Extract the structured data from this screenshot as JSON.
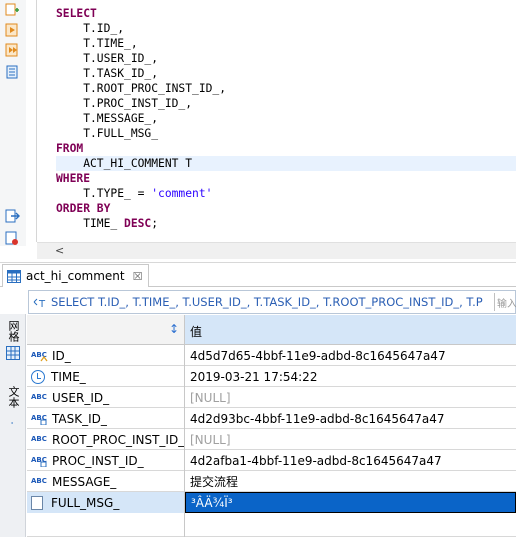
{
  "editor": {
    "lines": [
      {
        "parts": [
          {
            "t": "SELECT",
            "c": "kw"
          }
        ]
      },
      {
        "parts": [
          {
            "t": "    T.ID_,",
            "c": ""
          }
        ]
      },
      {
        "parts": [
          {
            "t": "    T.TIME_,",
            "c": ""
          }
        ]
      },
      {
        "parts": [
          {
            "t": "    T.USER_ID_,",
            "c": ""
          }
        ]
      },
      {
        "parts": [
          {
            "t": "    T.TASK_ID_,",
            "c": ""
          }
        ]
      },
      {
        "parts": [
          {
            "t": "    T.ROOT_PROC_INST_ID_,",
            "c": ""
          }
        ]
      },
      {
        "parts": [
          {
            "t": "    T.PROC_INST_ID_,",
            "c": ""
          }
        ]
      },
      {
        "parts": [
          {
            "t": "    T.MESSAGE_,",
            "c": ""
          }
        ]
      },
      {
        "parts": [
          {
            "t": "    T.FULL_MSG_",
            "c": ""
          }
        ]
      },
      {
        "parts": [
          {
            "t": "FROM",
            "c": "kw"
          }
        ]
      },
      {
        "parts": [
          {
            "t": "    ACT_HI_COMMENT T",
            "c": ""
          }
        ],
        "highlight": true
      },
      {
        "parts": [
          {
            "t": "WHERE",
            "c": "kw"
          }
        ]
      },
      {
        "parts": [
          {
            "t": "    T.TYPE_ = ",
            "c": ""
          },
          {
            "t": "'comment'",
            "c": "str"
          }
        ]
      },
      {
        "parts": [
          {
            "t": "ORDER BY",
            "c": "kw"
          }
        ]
      },
      {
        "parts": [
          {
            "t": "    TIME_ ",
            "c": ""
          },
          {
            "t": "DESC",
            "c": "kw"
          },
          {
            "t": ";",
            "c": ""
          }
        ]
      }
    ]
  },
  "results": {
    "tab_label": "act_hi_comment",
    "tab_close": "☒",
    "query_text": "SELECT T.ID_, T.TIME_, T.USER_ID_, T.TASK_ID_, T.ROOT_PROC_INST_ID_, T.P",
    "filter_placeholder": "输入",
    "side_tabs": {
      "grid": "网格",
      "text": "文本"
    },
    "value_header": "值",
    "rows": [
      {
        "name": "ID_",
        "value": "4d5d7d65-4bbf-11e9-adbd-8c1645647a47",
        "icon": "abc-key-icon",
        "null": false
      },
      {
        "name": "TIME_",
        "value": "2019-03-21 17:54:22",
        "icon": "clock-icon",
        "null": false
      },
      {
        "name": "USER_ID_",
        "value": "[NULL]",
        "icon": "abc-icon",
        "null": true
      },
      {
        "name": "TASK_ID_",
        "value": "4d2d93bc-4bbf-11e9-adbd-8c1645647a47",
        "icon": "abc-index-icon",
        "null": false
      },
      {
        "name": "ROOT_PROC_INST_ID_",
        "value": "[NULL]",
        "icon": "abc-icon",
        "null": true
      },
      {
        "name": "PROC_INST_ID_",
        "value": "4d2afba1-4bbf-11e9-adbd-8c1645647a47",
        "icon": "abc-index-icon",
        "null": false
      },
      {
        "name": "MESSAGE_",
        "value": "提交流程",
        "icon": "abc-icon",
        "null": false
      },
      {
        "name": "FULL_MSG_",
        "value": "³ÂÄ¾Ï³",
        "icon": "binary-doc-icon",
        "null": false,
        "selected": true
      }
    ]
  },
  "colors": {
    "keyword": "#7f0055",
    "string": "#2a00ff",
    "selection": "#0a64c8",
    "header_value_bg": "#d5e6f8"
  }
}
